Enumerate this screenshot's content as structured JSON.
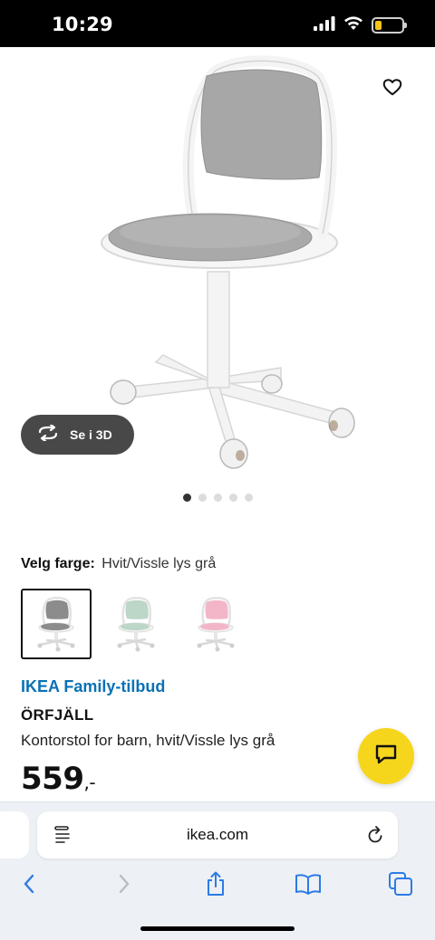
{
  "status_bar": {
    "time": "10:29",
    "icons": [
      "signal-icon",
      "wifi-icon",
      "battery-icon"
    ],
    "battery_level": 0.25,
    "battery_color": "#f5c518"
  },
  "product_gallery": {
    "view_3d_label": "Se i 3D",
    "image_count": 5,
    "active_image": 1
  },
  "color_picker": {
    "label": "Velg farge:",
    "selected_value": "Hvit/Vissle lys grå",
    "options": [
      {
        "name": "grey",
        "seat_color": "#8c8c8c",
        "selected": true
      },
      {
        "name": "mint",
        "seat_color": "#bcd6c8",
        "selected": false
      },
      {
        "name": "pink",
        "seat_color": "#f2b6c8",
        "selected": false
      }
    ]
  },
  "product": {
    "family_offer": "IKEA Family-tilbud",
    "name": "ÖRFJÄLL",
    "description": "Kontorstol for barn, hvit/Vissle lys grå",
    "price": "559",
    "price_suffix": ",-"
  },
  "browser": {
    "url": "ikea.com",
    "toolbar_icons": [
      "back-icon",
      "forward-icon",
      "share-icon",
      "bookmarks-icon",
      "tabs-icon"
    ]
  },
  "colors": {
    "family_blue": "#0a71b6",
    "chat_yellow": "#f6d61d",
    "safari_blue": "#2c7be5"
  }
}
